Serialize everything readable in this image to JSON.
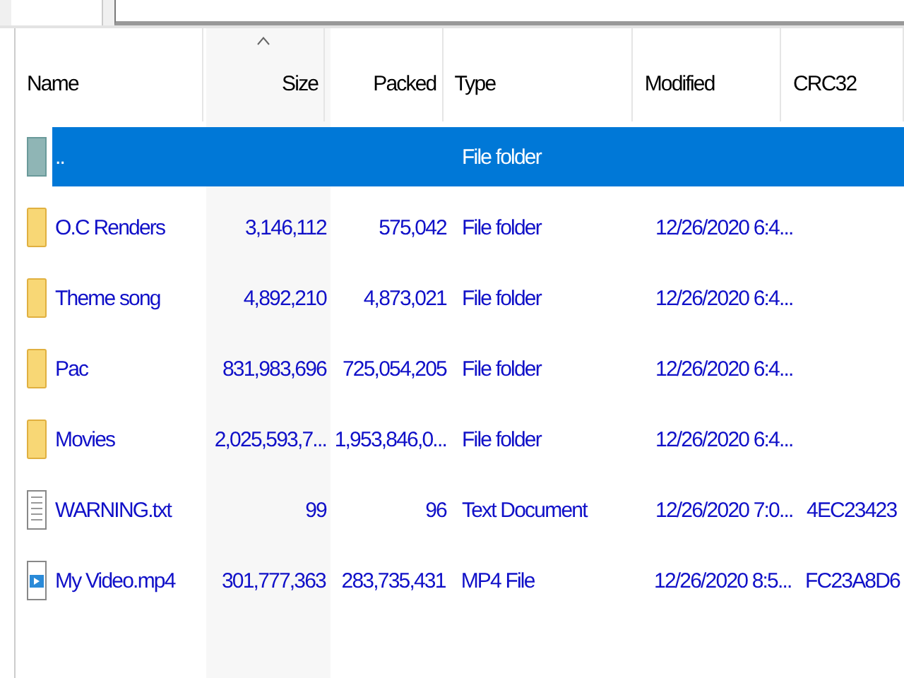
{
  "columns": [
    {
      "label": "Name",
      "sorted": false
    },
    {
      "label": "Size",
      "sorted": true
    },
    {
      "label": "Packed",
      "sorted": false
    },
    {
      "label": "Type",
      "sorted": false
    },
    {
      "label": "Modified",
      "sorted": false
    },
    {
      "label": "CRC32",
      "sorted": false
    }
  ],
  "rows": [
    {
      "kind": "parent",
      "name": "..",
      "size": "",
      "packed": "",
      "type": "File folder",
      "modified": "",
      "crc": "",
      "selected": true
    },
    {
      "kind": "folder",
      "name": "O.C Renders",
      "size": "3,146,112",
      "packed": "575,042",
      "type": "File folder",
      "modified": "12/26/2020 6:4...",
      "crc": "",
      "selected": false
    },
    {
      "kind": "folder",
      "name": "Theme song",
      "size": "4,892,210",
      "packed": "4,873,021",
      "type": "File folder",
      "modified": "12/26/2020 6:4...",
      "crc": "",
      "selected": false
    },
    {
      "kind": "folder",
      "name": "Pac",
      "size": "831,983,696",
      "packed": "725,054,205",
      "type": "File folder",
      "modified": "12/26/2020 6:4...",
      "crc": "",
      "selected": false
    },
    {
      "kind": "folder",
      "name": "Movies",
      "size": "2,025,593,7...",
      "packed": "1,953,846,0...",
      "type": "File folder",
      "modified": "12/26/2020 6:4...",
      "crc": "",
      "selected": false
    },
    {
      "kind": "text",
      "name": "WARNING.txt",
      "size": "99",
      "packed": "96",
      "type": "Text Document",
      "modified": "12/26/2020 7:0...",
      "crc": "4EC23423",
      "selected": false
    },
    {
      "kind": "video",
      "name": "My Video.mp4",
      "size": "301,777,363",
      "packed": "283,735,431",
      "type": "MP4 File",
      "modified": "12/26/2020 8:5...",
      "crc": "FC23A8D6",
      "selected": false
    }
  ]
}
